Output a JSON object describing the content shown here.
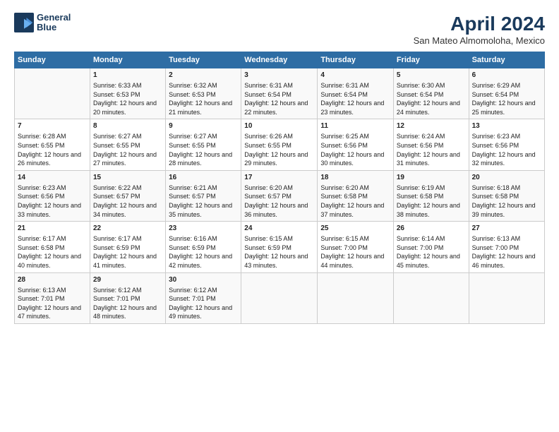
{
  "logo": {
    "line1": "General",
    "line2": "Blue"
  },
  "title": "April 2024",
  "subtitle": "San Mateo Almomoloha, Mexico",
  "days_header": [
    "Sunday",
    "Monday",
    "Tuesday",
    "Wednesday",
    "Thursday",
    "Friday",
    "Saturday"
  ],
  "weeks": [
    [
      {
        "day": "",
        "sunrise": "",
        "sunset": "",
        "daylight": ""
      },
      {
        "day": "1",
        "sunrise": "Sunrise: 6:33 AM",
        "sunset": "Sunset: 6:53 PM",
        "daylight": "Daylight: 12 hours and 20 minutes."
      },
      {
        "day": "2",
        "sunrise": "Sunrise: 6:32 AM",
        "sunset": "Sunset: 6:53 PM",
        "daylight": "Daylight: 12 hours and 21 minutes."
      },
      {
        "day": "3",
        "sunrise": "Sunrise: 6:31 AM",
        "sunset": "Sunset: 6:54 PM",
        "daylight": "Daylight: 12 hours and 22 minutes."
      },
      {
        "day": "4",
        "sunrise": "Sunrise: 6:31 AM",
        "sunset": "Sunset: 6:54 PM",
        "daylight": "Daylight: 12 hours and 23 minutes."
      },
      {
        "day": "5",
        "sunrise": "Sunrise: 6:30 AM",
        "sunset": "Sunset: 6:54 PM",
        "daylight": "Daylight: 12 hours and 24 minutes."
      },
      {
        "day": "6",
        "sunrise": "Sunrise: 6:29 AM",
        "sunset": "Sunset: 6:54 PM",
        "daylight": "Daylight: 12 hours and 25 minutes."
      }
    ],
    [
      {
        "day": "7",
        "sunrise": "Sunrise: 6:28 AM",
        "sunset": "Sunset: 6:55 PM",
        "daylight": "Daylight: 12 hours and 26 minutes."
      },
      {
        "day": "8",
        "sunrise": "Sunrise: 6:27 AM",
        "sunset": "Sunset: 6:55 PM",
        "daylight": "Daylight: 12 hours and 27 minutes."
      },
      {
        "day": "9",
        "sunrise": "Sunrise: 6:27 AM",
        "sunset": "Sunset: 6:55 PM",
        "daylight": "Daylight: 12 hours and 28 minutes."
      },
      {
        "day": "10",
        "sunrise": "Sunrise: 6:26 AM",
        "sunset": "Sunset: 6:55 PM",
        "daylight": "Daylight: 12 hours and 29 minutes."
      },
      {
        "day": "11",
        "sunrise": "Sunrise: 6:25 AM",
        "sunset": "Sunset: 6:56 PM",
        "daylight": "Daylight: 12 hours and 30 minutes."
      },
      {
        "day": "12",
        "sunrise": "Sunrise: 6:24 AM",
        "sunset": "Sunset: 6:56 PM",
        "daylight": "Daylight: 12 hours and 31 minutes."
      },
      {
        "day": "13",
        "sunrise": "Sunrise: 6:23 AM",
        "sunset": "Sunset: 6:56 PM",
        "daylight": "Daylight: 12 hours and 32 minutes."
      }
    ],
    [
      {
        "day": "14",
        "sunrise": "Sunrise: 6:23 AM",
        "sunset": "Sunset: 6:56 PM",
        "daylight": "Daylight: 12 hours and 33 minutes."
      },
      {
        "day": "15",
        "sunrise": "Sunrise: 6:22 AM",
        "sunset": "Sunset: 6:57 PM",
        "daylight": "Daylight: 12 hours and 34 minutes."
      },
      {
        "day": "16",
        "sunrise": "Sunrise: 6:21 AM",
        "sunset": "Sunset: 6:57 PM",
        "daylight": "Daylight: 12 hours and 35 minutes."
      },
      {
        "day": "17",
        "sunrise": "Sunrise: 6:20 AM",
        "sunset": "Sunset: 6:57 PM",
        "daylight": "Daylight: 12 hours and 36 minutes."
      },
      {
        "day": "18",
        "sunrise": "Sunrise: 6:20 AM",
        "sunset": "Sunset: 6:58 PM",
        "daylight": "Daylight: 12 hours and 37 minutes."
      },
      {
        "day": "19",
        "sunrise": "Sunrise: 6:19 AM",
        "sunset": "Sunset: 6:58 PM",
        "daylight": "Daylight: 12 hours and 38 minutes."
      },
      {
        "day": "20",
        "sunrise": "Sunrise: 6:18 AM",
        "sunset": "Sunset: 6:58 PM",
        "daylight": "Daylight: 12 hours and 39 minutes."
      }
    ],
    [
      {
        "day": "21",
        "sunrise": "Sunrise: 6:17 AM",
        "sunset": "Sunset: 6:58 PM",
        "daylight": "Daylight: 12 hours and 40 minutes."
      },
      {
        "day": "22",
        "sunrise": "Sunrise: 6:17 AM",
        "sunset": "Sunset: 6:59 PM",
        "daylight": "Daylight: 12 hours and 41 minutes."
      },
      {
        "day": "23",
        "sunrise": "Sunrise: 6:16 AM",
        "sunset": "Sunset: 6:59 PM",
        "daylight": "Daylight: 12 hours and 42 minutes."
      },
      {
        "day": "24",
        "sunrise": "Sunrise: 6:15 AM",
        "sunset": "Sunset: 6:59 PM",
        "daylight": "Daylight: 12 hours and 43 minutes."
      },
      {
        "day": "25",
        "sunrise": "Sunrise: 6:15 AM",
        "sunset": "Sunset: 7:00 PM",
        "daylight": "Daylight: 12 hours and 44 minutes."
      },
      {
        "day": "26",
        "sunrise": "Sunrise: 6:14 AM",
        "sunset": "Sunset: 7:00 PM",
        "daylight": "Daylight: 12 hours and 45 minutes."
      },
      {
        "day": "27",
        "sunrise": "Sunrise: 6:13 AM",
        "sunset": "Sunset: 7:00 PM",
        "daylight": "Daylight: 12 hours and 46 minutes."
      }
    ],
    [
      {
        "day": "28",
        "sunrise": "Sunrise: 6:13 AM",
        "sunset": "Sunset: 7:01 PM",
        "daylight": "Daylight: 12 hours and 47 minutes."
      },
      {
        "day": "29",
        "sunrise": "Sunrise: 6:12 AM",
        "sunset": "Sunset: 7:01 PM",
        "daylight": "Daylight: 12 hours and 48 minutes."
      },
      {
        "day": "30",
        "sunrise": "Sunrise: 6:12 AM",
        "sunset": "Sunset: 7:01 PM",
        "daylight": "Daylight: 12 hours and 49 minutes."
      },
      {
        "day": "",
        "sunrise": "",
        "sunset": "",
        "daylight": ""
      },
      {
        "day": "",
        "sunrise": "",
        "sunset": "",
        "daylight": ""
      },
      {
        "day": "",
        "sunrise": "",
        "sunset": "",
        "daylight": ""
      },
      {
        "day": "",
        "sunrise": "",
        "sunset": "",
        "daylight": ""
      }
    ]
  ]
}
